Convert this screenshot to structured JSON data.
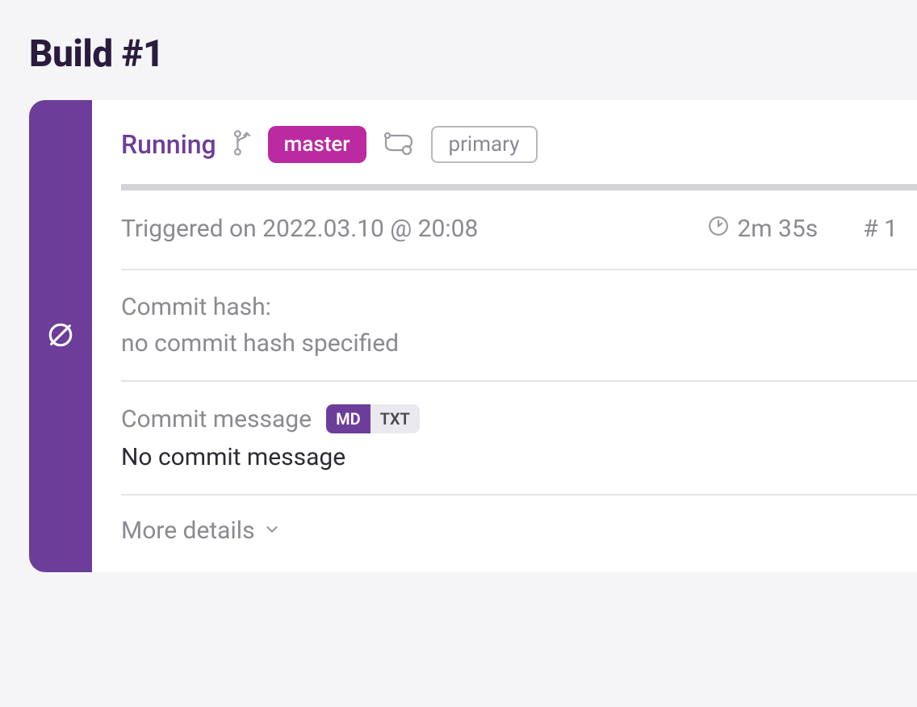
{
  "page_title": "Build #1",
  "status": {
    "label": "Running",
    "branch": "master",
    "workflow": "primary"
  },
  "meta": {
    "triggered_text": "Triggered on 2022.03.10 @ 20:08",
    "duration": "2m 35s",
    "build_number": "# 1"
  },
  "commit_hash": {
    "label": "Commit hash:",
    "value": "no commit hash specified"
  },
  "commit_message": {
    "label": "Commit message",
    "toggle_md": "MD",
    "toggle_txt": "TXT",
    "value": "No commit message"
  },
  "more_details_label": "More details"
}
